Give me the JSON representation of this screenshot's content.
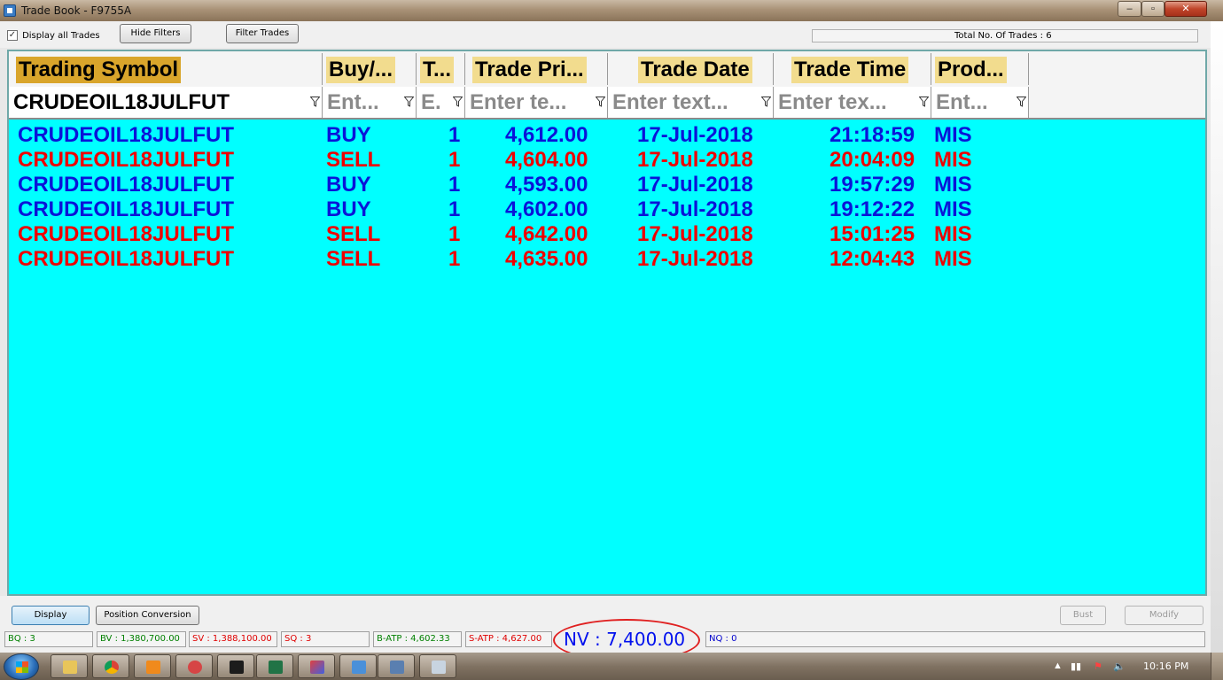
{
  "window": {
    "title": "Trade Book - F9755A"
  },
  "toolbar": {
    "display_all_label": "Display all Trades",
    "display_all_checked": true,
    "hide_filters_label": "Hide Filters",
    "filter_trades_label": "Filter Trades",
    "total_trades_label": "Total No. Of Trades : 6"
  },
  "grid": {
    "headers": [
      "Trading Symbol",
      "Buy/...",
      "T...",
      "Trade Pri...",
      "Trade Date",
      "Trade Time",
      "Prod..."
    ],
    "filters": [
      "CRUDEOIL18JULFUT",
      "Ent...",
      "E.",
      "Enter te...",
      "Enter text...",
      "Enter tex...",
      "Ent..."
    ],
    "rows": [
      {
        "symbol": "CRUDEOIL18JULFUT",
        "side": "BUY",
        "qty": "1",
        "price": "4,612.00",
        "date": "17-Jul-2018",
        "time": "21:18:59",
        "product": "MIS"
      },
      {
        "symbol": "CRUDEOIL18JULFUT",
        "side": "SELL",
        "qty": "1",
        "price": "4,604.00",
        "date": "17-Jul-2018",
        "time": "20:04:09",
        "product": "MIS"
      },
      {
        "symbol": "CRUDEOIL18JULFUT",
        "side": "BUY",
        "qty": "1",
        "price": "4,593.00",
        "date": "17-Jul-2018",
        "time": "19:57:29",
        "product": "MIS"
      },
      {
        "symbol": "CRUDEOIL18JULFUT",
        "side": "BUY",
        "qty": "1",
        "price": "4,602.00",
        "date": "17-Jul-2018",
        "time": "19:12:22",
        "product": "MIS"
      },
      {
        "symbol": "CRUDEOIL18JULFUT",
        "side": "SELL",
        "qty": "1",
        "price": "4,642.00",
        "date": "17-Jul-2018",
        "time": "15:01:25",
        "product": "MIS"
      },
      {
        "symbol": "CRUDEOIL18JULFUT",
        "side": "SELL",
        "qty": "1",
        "price": "4,635.00",
        "date": "17-Jul-2018",
        "time": "12:04:43",
        "product": "MIS"
      }
    ],
    "colors": {
      "background": "#00ffff",
      "buy": "#0a14d8",
      "sell": "#ee0000",
      "header_first": "#d9a52b",
      "header": "#f2dc8e"
    }
  },
  "actions": {
    "display_label": "Display",
    "position_conversion_label": "Position Conversion",
    "bust_label": "Bust",
    "modify_label": "Modify"
  },
  "status": {
    "bq": "BQ : 3",
    "bv": "BV : 1,380,700.00",
    "sv": "SV : 1,388,100.00",
    "sq": "SQ : 3",
    "batp": "B-ATP : 4,602.33",
    "satp": "S-ATP : 4,627.00",
    "nv": "NV : 7,400.00",
    "nq": "NQ : 0"
  },
  "taskbar": {
    "clock": "10:16 PM",
    "apps": [
      "explorer-icon",
      "chrome-icon",
      "media-player-icon",
      "app-icon",
      "chart-icon",
      "excel-icon",
      "triangle-app-icon",
      "paint-icon",
      "window-icon",
      "calculator-icon"
    ]
  }
}
